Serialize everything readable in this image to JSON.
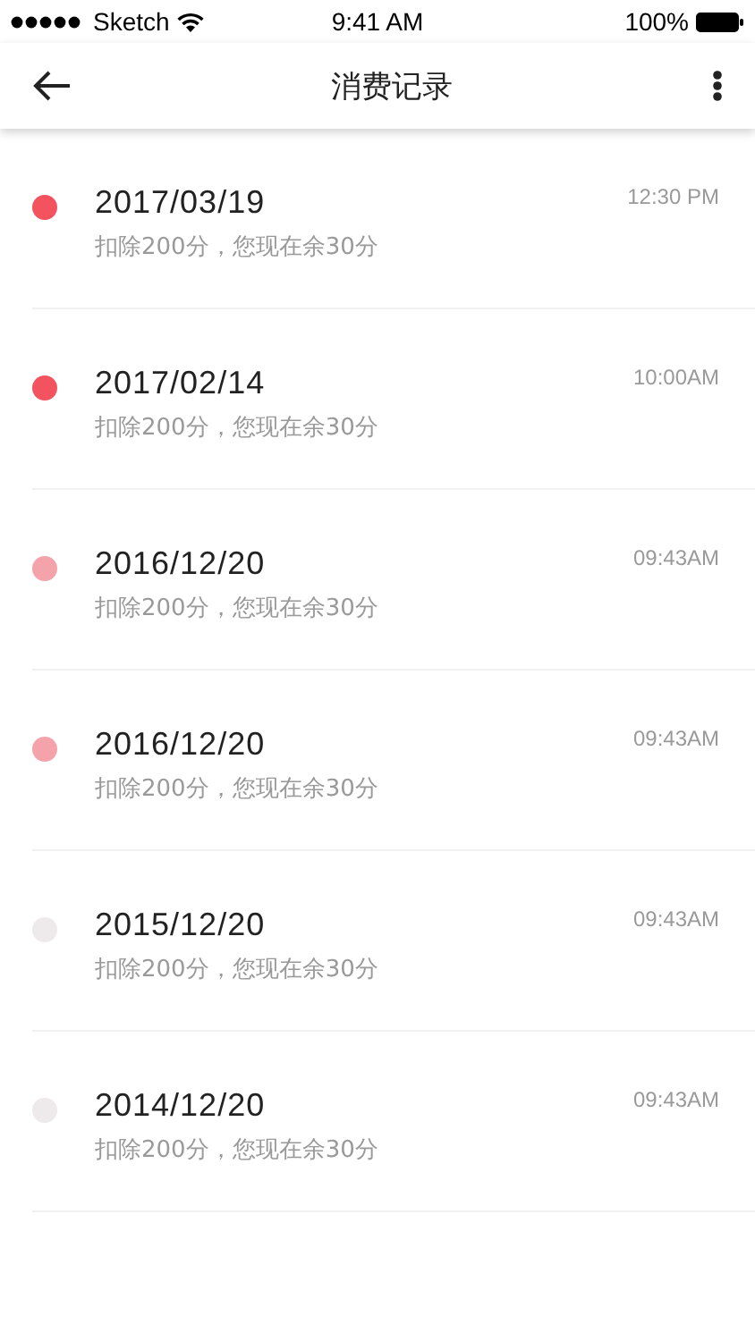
{
  "status_bar": {
    "carrier": "Sketch",
    "time": "9:41 AM",
    "battery": "100%"
  },
  "nav": {
    "title": "消费记录"
  },
  "records": [
    {
      "date": "2017/03/19",
      "detail": "扣除200分，您现在余30分",
      "time": "12:30 PM",
      "color": "#f2535e"
    },
    {
      "date": "2017/02/14",
      "detail": "扣除200分，您现在余30分",
      "time": "10:00AM",
      "color": "#f2535e"
    },
    {
      "date": "2016/12/20",
      "detail": "扣除200分，您现在余30分",
      "time": "09:43AM",
      "color": "#f4a3aa"
    },
    {
      "date": "2016/12/20",
      "detail": "扣除200分，您现在余30分",
      "time": "09:43AM",
      "color": "#f4a3aa"
    },
    {
      "date": "2015/12/20",
      "detail": "扣除200分，您现在余30分",
      "time": "09:43AM",
      "color": "#eee9ea"
    },
    {
      "date": "2014/12/20",
      "detail": "扣除200分，您现在余30分",
      "time": "09:43AM",
      "color": "#eee9ea"
    }
  ]
}
